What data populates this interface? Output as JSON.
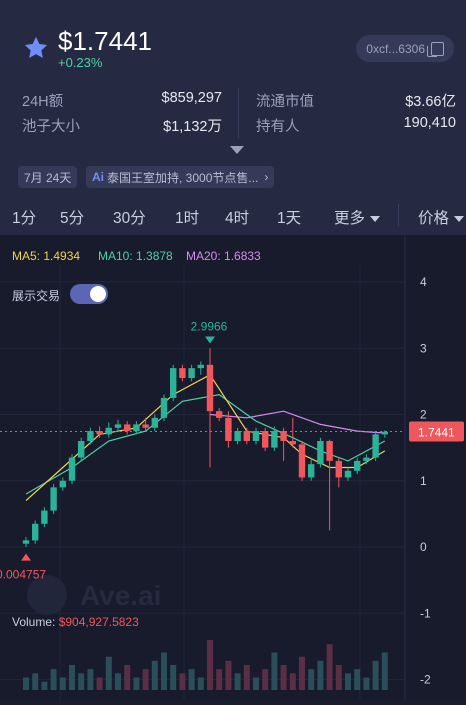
{
  "token": {
    "price": "$1.7441",
    "change": "+0.23%",
    "address": "0xcf...6306",
    "icon": "star-icon"
  },
  "stats": {
    "vol_label": "24H额",
    "vol_value": "$859,297",
    "mcap_label": "流通市值",
    "mcap_value": "$3.66亿",
    "pool_label": "池子大小",
    "pool_value": "$1,132万",
    "holders_label": "持有人",
    "holders_value": "190,410"
  },
  "chips": {
    "age": "7月 24天",
    "news": "泰国王室加持, 3000节点售..."
  },
  "tabs": {
    "t1": "1分",
    "t5": "5分",
    "t30": "30分",
    "t1h": "1时",
    "t4h": "4时",
    "t1d": "1天",
    "more": "更多",
    "price": "价格"
  },
  "chart_overlay": {
    "ma5": "MA5: 1.4934",
    "ma10": "MA10: 1.3878",
    "ma20": "MA20: 1.6833",
    "show_trades": "展示交易",
    "volume_label": "Volume:",
    "volume_value": "$904,927.5823",
    "high_label": "2.9966",
    "low_label": "0.004757",
    "current_label": "1.7441",
    "watermark": "Ave.ai"
  },
  "colors": {
    "up": "#2bb39a",
    "down": "#f0575d",
    "ma5": "#f0d34f",
    "ma10": "#4fd0a6",
    "ma20": "#d78cf0",
    "accent": "#5b67b5"
  },
  "chart_data": {
    "type": "candlestick",
    "y_axis_ticks": [
      "4",
      "3",
      "2",
      "1",
      "0",
      "-1",
      "-2"
    ],
    "ylim": [
      -2.1,
      4.3
    ],
    "current_price": 1.7441,
    "max_marker": 2.9966,
    "min_marker": 0.004757,
    "candles": [
      [
        0.05,
        0.1,
        0.0,
        0.15
      ],
      [
        0.1,
        0.35,
        0.05,
        0.4
      ],
      [
        0.35,
        0.55,
        0.3,
        0.6
      ],
      [
        0.55,
        0.9,
        0.5,
        0.95
      ],
      [
        0.9,
        1.0,
        0.85,
        1.05
      ],
      [
        1.0,
        1.35,
        0.95,
        1.4
      ],
      [
        1.35,
        1.6,
        1.3,
        1.65
      ],
      [
        1.6,
        1.75,
        1.55,
        1.8
      ],
      [
        1.75,
        1.7,
        1.65,
        1.82
      ],
      [
        1.7,
        1.8,
        1.65,
        1.88
      ],
      [
        1.8,
        1.85,
        1.75,
        1.92
      ],
      [
        1.85,
        1.75,
        1.7,
        1.9
      ],
      [
        1.75,
        1.85,
        1.7,
        1.9
      ],
      [
        1.85,
        1.8,
        1.75,
        1.95
      ],
      [
        1.8,
        1.95,
        1.75,
        2.0
      ],
      [
        1.95,
        2.25,
        1.9,
        2.3
      ],
      [
        2.25,
        2.7,
        2.2,
        2.75
      ],
      [
        2.7,
        2.55,
        2.5,
        2.75
      ],
      [
        2.55,
        2.7,
        2.5,
        2.75
      ],
      [
        2.7,
        2.75,
        2.6,
        2.8
      ],
      [
        2.75,
        2.05,
        1.2,
        3.0
      ],
      [
        2.05,
        1.95,
        1.9,
        2.1
      ],
      [
        1.95,
        1.6,
        1.5,
        2.05
      ],
      [
        1.6,
        1.75,
        1.55,
        1.8
      ],
      [
        1.75,
        1.6,
        1.55,
        1.8
      ],
      [
        1.6,
        1.75,
        1.55,
        1.8
      ],
      [
        1.75,
        1.5,
        1.45,
        1.8
      ],
      [
        1.5,
        1.75,
        1.45,
        1.82
      ],
      [
        1.75,
        1.6,
        1.3,
        1.8
      ],
      [
        1.6,
        1.55,
        1.5,
        1.95
      ],
      [
        1.55,
        1.05,
        1.0,
        1.6
      ],
      [
        1.05,
        1.25,
        1.0,
        1.35
      ],
      [
        1.25,
        1.6,
        1.2,
        1.65
      ],
      [
        1.6,
        1.3,
        0.25,
        1.62
      ],
      [
        1.3,
        1.05,
        0.9,
        1.35
      ],
      [
        1.05,
        1.15,
        1.0,
        1.2
      ],
      [
        1.15,
        1.3,
        1.1,
        1.35
      ],
      [
        1.3,
        1.35,
        1.25,
        1.4
      ],
      [
        1.35,
        1.7,
        1.3,
        1.75
      ],
      [
        1.7,
        1.74,
        1.65,
        1.76
      ]
    ],
    "volumes": [
      3,
      4,
      2,
      5,
      3,
      6,
      4,
      5,
      3,
      8,
      4,
      6,
      3,
      5,
      7,
      9,
      6,
      4,
      5,
      3,
      12,
      5,
      7,
      4,
      6,
      3,
      5,
      9,
      6,
      4,
      8,
      5,
      7,
      11,
      6,
      4,
      5,
      3,
      7,
      9
    ],
    "ma5": [
      [
        0,
        0.7
      ],
      [
        4,
        1.2
      ],
      [
        8,
        1.7
      ],
      [
        12,
        1.8
      ],
      [
        16,
        2.3
      ],
      [
        20,
        2.6
      ],
      [
        24,
        1.75
      ],
      [
        28,
        1.65
      ],
      [
        30,
        1.4
      ],
      [
        33,
        1.2
      ],
      [
        36,
        1.2
      ],
      [
        39,
        1.45
      ]
    ],
    "ma10": [
      [
        0,
        0.8
      ],
      [
        5,
        1.2
      ],
      [
        9,
        1.6
      ],
      [
        13,
        1.75
      ],
      [
        17,
        2.2
      ],
      [
        21,
        2.3
      ],
      [
        25,
        1.9
      ],
      [
        29,
        1.65
      ],
      [
        32,
        1.45
      ],
      [
        35,
        1.3
      ],
      [
        39,
        1.6
      ]
    ],
    "ma20": [
      [
        20,
        2.0
      ],
      [
        24,
        1.95
      ],
      [
        28,
        2.05
      ],
      [
        32,
        1.85
      ],
      [
        36,
        1.75
      ],
      [
        39,
        1.72
      ]
    ]
  }
}
